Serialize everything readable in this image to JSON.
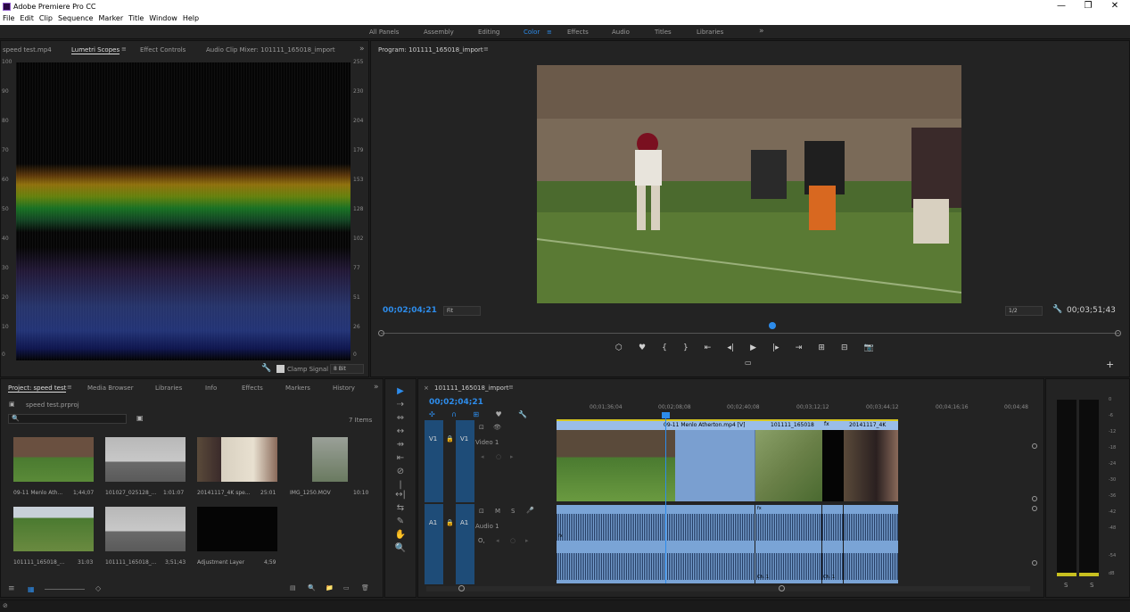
{
  "window": {
    "title": "Adobe Premiere Pro CC",
    "controls": [
      "—",
      "❐",
      "✕"
    ]
  },
  "menu": [
    "File",
    "Edit",
    "Clip",
    "Sequence",
    "Marker",
    "Title",
    "Window",
    "Help"
  ],
  "workspaces": {
    "items": [
      "All Panels",
      "Assembly",
      "Editing",
      "Color",
      "Effects",
      "Audio",
      "Titles",
      "Libraries"
    ],
    "active": "Color",
    "more": "»",
    "menu_glyph": "≡"
  },
  "source_panel": {
    "tabs": [
      "speed test.mp4",
      "Lumetri Scopes",
      "Effect Controls",
      "Audio Clip Mixer: 101111_165018_import"
    ],
    "active_tab": "Lumetri Scopes",
    "more": "»",
    "scope_left_axis": [
      "100",
      "90",
      "80",
      "70",
      "60",
      "50",
      "40",
      "30",
      "20",
      "10",
      "0"
    ],
    "scope_right_axis": [
      "255",
      "230",
      "204",
      "179",
      "153",
      "128",
      "102",
      "77",
      "51",
      "26",
      "0"
    ],
    "clamp_label": "Clamp Signal",
    "bit_depth": "8 Bit"
  },
  "program": {
    "title": "Program: 101111_165018_import",
    "timecode": "00;02;04;21",
    "fit": "Fit",
    "resolution": "1/2",
    "duration": "00;03;51;43",
    "playhead_fraction": 0.53,
    "transport": [
      "⬡",
      "♥",
      "{",
      "}",
      "⇤",
      "◂|",
      "▶",
      "|▸",
      "⇥",
      "⊞",
      "⊟",
      "📷"
    ],
    "add": "+"
  },
  "project": {
    "tabs": [
      "Project: speed test",
      "Media Browser",
      "Libraries",
      "Info",
      "Effects",
      "Markers",
      "History"
    ],
    "active_tab": "Project: speed test",
    "more": "»",
    "file": "speed test.prproj",
    "item_count": "7 Items",
    "items": [
      {
        "name": "09-11 Menlo Ath...",
        "duration": "1;44;07"
      },
      {
        "name": "101027_025128_...",
        "duration": "1:01:07"
      },
      {
        "name": "20141117_4K spe...",
        "duration": "25:01"
      },
      {
        "name": "IMG_1250.MOV",
        "duration": "10:10"
      },
      {
        "name": "101111_165018_...",
        "duration": "31:03"
      },
      {
        "name": "101111_165018_...",
        "duration": "3;51;43"
      },
      {
        "name": "Adjustment Layer",
        "duration": "4;59"
      }
    ]
  },
  "timeline": {
    "close": "×",
    "title": "101111_165018_import",
    "timecode": "00;02;04;21",
    "ruler": [
      "00;01;36;04",
      "00;02;08;08",
      "00;02;40;08",
      "00;03;12;12",
      "00;03;44;12",
      "00;04;16;16",
      "00;04;48"
    ],
    "tracks": {
      "v1": {
        "label": "V1",
        "name": "Video 1"
      },
      "a1": {
        "label": "A1",
        "name": "Audio 1"
      }
    },
    "clips": [
      "09-11 Menlo Atherton.mp4 [V]",
      "101111_165018",
      "fx",
      "20141117_4K"
    ],
    "track_toggles": [
      "M",
      "S",
      "🎤"
    ],
    "track_symbols": {
      "camera": "⊡",
      "eye": "👁",
      "lock": "🔒",
      "target_left": "◂",
      "target_right": "▸",
      "circle": "○",
      "zero": "0",
      "vol": "O,"
    },
    "clip_badges": {
      "fx_left": "fx",
      "fx_right": "fx",
      "clip1": "Ch. 1",
      "clip2": "Ch. 1"
    },
    "toolbar_icons": [
      "✣",
      "∩",
      "⊞",
      "♥",
      "🔧"
    ]
  },
  "tools": [
    "▶",
    "⇢",
    "⇔",
    "↔",
    "⇸",
    "⇤",
    "⊘",
    "|↔|",
    "⇆",
    "✎",
    "✋",
    "🔍"
  ],
  "meter": {
    "ticks": [
      "0",
      "-6",
      "-12",
      "-18",
      "-24",
      "-30",
      "-36",
      "-42",
      "-48",
      "-54",
      "dB"
    ],
    "solo": [
      "S",
      "S"
    ],
    "level_fraction": 0.02
  },
  "bottom_icons": {
    "list": "≡",
    "grid": "▦",
    "zoom": "◇",
    "icons": [
      "▤",
      "🔍",
      "📁",
      "▭",
      "🗑"
    ],
    "search": "🔍",
    "new_bin": "▣",
    "wrench": "🔧",
    "status": "⊘"
  }
}
